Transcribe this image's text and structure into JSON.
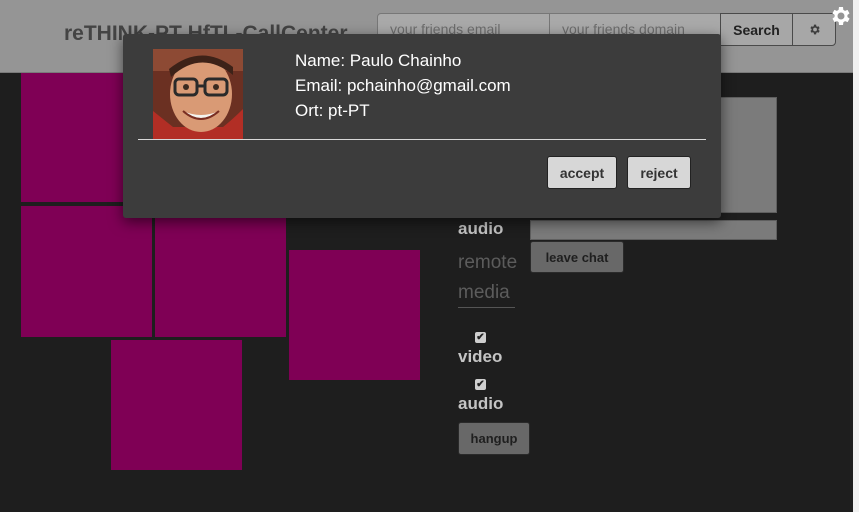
{
  "header": {
    "title": "reTHINK-PT HfTL-CallCenter",
    "email_placeholder": "your friends email",
    "domain_placeholder": "your friends domain",
    "search_label": "Search"
  },
  "local_media": {
    "audio_label": "audio"
  },
  "chat": {
    "leave_label": "leave chat"
  },
  "remote_media": {
    "heading_line1": "remote",
    "heading_line2": "media",
    "video_label": "video",
    "audio_label": "audio",
    "video_checked": true,
    "audio_checked": true,
    "hangup_label": "hangup"
  },
  "incoming_call": {
    "name": "Name: Paulo Chainho",
    "email": "Email: pchainho@gmail.com",
    "ort": "Ort: pt-PT",
    "accept_label": "accept",
    "reject_label": "reject"
  },
  "colors": {
    "tile": "#7f0055",
    "topbar": "#959595",
    "background": "#1e1e1e",
    "modal": "#3c3c3c"
  },
  "icons": [
    "gear-icon",
    "settings-gear-icon",
    "checkbox-icon"
  ]
}
